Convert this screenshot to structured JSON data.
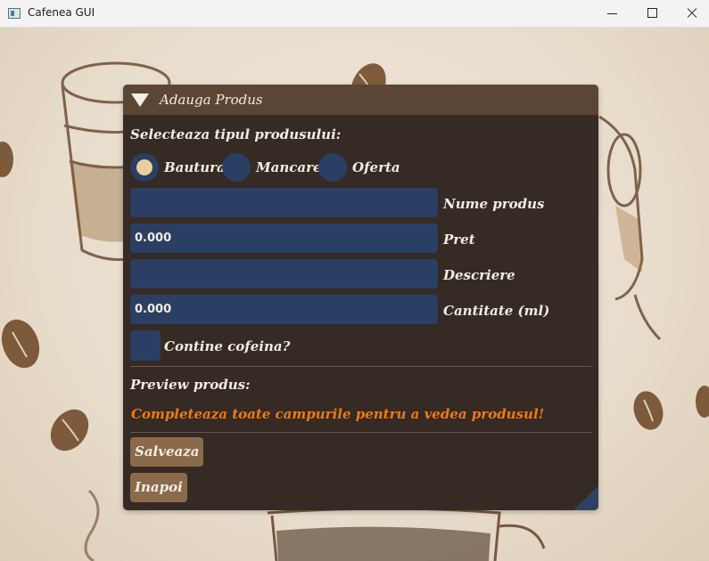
{
  "window": {
    "title": "Cafenea GUI",
    "icon": "app-window-icon",
    "controls": [
      "minimize-icon",
      "maximize-icon",
      "close-icon"
    ]
  },
  "dialog": {
    "title": "Adauga Produs",
    "collapse_icon": "triangle-down-icon",
    "type_label": "Selecteaza tipul produsului:",
    "product_types": [
      {
        "label": "Bautura",
        "selected": true
      },
      {
        "label": "Mancare",
        "selected": false
      },
      {
        "label": "Oferta",
        "selected": false
      }
    ],
    "fields": {
      "name_label": "Nume produs",
      "name_value": "",
      "price_label": "Pret",
      "price_value": "0.000",
      "description_label": "Descriere",
      "description_value": "",
      "quantity_label": "Cantitate (ml)",
      "quantity_value": "0.000"
    },
    "caffeine_label": "Contine cofeina?",
    "caffeine_checked": false,
    "preview_label": "Preview produs:",
    "preview_message": "Completeaza toate campurile pentru a vedea produsul!",
    "save_label": "Salveaza",
    "back_label": "Inapoi"
  },
  "colors": {
    "panel": "#352a24",
    "header": "#5b4636",
    "input": "#2a3f63",
    "radio_dot": "#e9cf9b",
    "warning": "#f07a11",
    "button": "#8b6a4c",
    "text": "#f3ece4"
  }
}
